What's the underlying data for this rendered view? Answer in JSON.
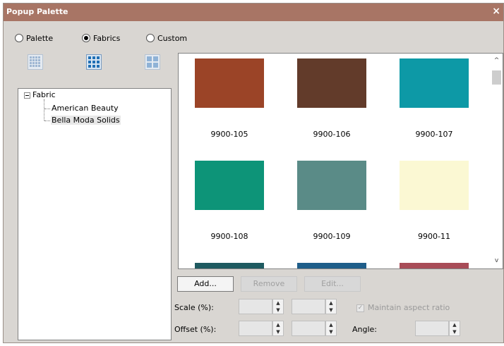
{
  "window": {
    "title": "Popup Palette",
    "close_glyph": "×"
  },
  "mode": {
    "options": [
      {
        "label": "Palette",
        "checked": false
      },
      {
        "label": "Fabrics",
        "checked": true
      },
      {
        "label": "Custom",
        "checked": false
      }
    ]
  },
  "view_buttons": [
    {
      "icon": "small-grid-icon",
      "active": false
    },
    {
      "icon": "medium-grid-icon",
      "active": true
    },
    {
      "icon": "large-grid-icon",
      "active": false
    }
  ],
  "tree": {
    "root": {
      "label": "Fabric",
      "expander": "minus"
    },
    "children": [
      {
        "label": "American Beauty",
        "selected": false
      },
      {
        "label": "Bella Moda Solids",
        "selected": true
      }
    ]
  },
  "swatches": [
    {
      "label": "9900-105",
      "color": "#9b4427"
    },
    {
      "label": "9900-106",
      "color": "#623b2a"
    },
    {
      "label": "9900-107",
      "color": "#0d99a6"
    },
    {
      "label": "9900-108",
      "color": "#0d9478"
    },
    {
      "label": "9900-109",
      "color": "#5a8b87"
    },
    {
      "label": "9900-11",
      "color": "#fbf8d3"
    },
    {
      "label": "",
      "color": "#1e5a60"
    },
    {
      "label": "",
      "color": "#1f5e8a"
    },
    {
      "label": "",
      "color": "#a84c57"
    }
  ],
  "scrollbar": {
    "up": "^",
    "down": "v"
  },
  "buttons": {
    "add": "Add...",
    "remove": "Remove",
    "edit": "Edit..."
  },
  "scale": {
    "label": "Scale (%):",
    "value_x": "",
    "value_y": ""
  },
  "offset": {
    "label": "Offset (%):",
    "value_x": "",
    "value_y": ""
  },
  "maintain_aspect": {
    "label": "Maintain aspect ratio",
    "checked": true,
    "enabled": false
  },
  "angle": {
    "label": "Angle:",
    "value": ""
  },
  "spinner": {
    "up": "▲",
    "down": "▼"
  },
  "colors": {
    "title_bar": "#a87565",
    "dialog_bg": "#d9d6d2",
    "accent_blue": "#1f6fb5"
  }
}
